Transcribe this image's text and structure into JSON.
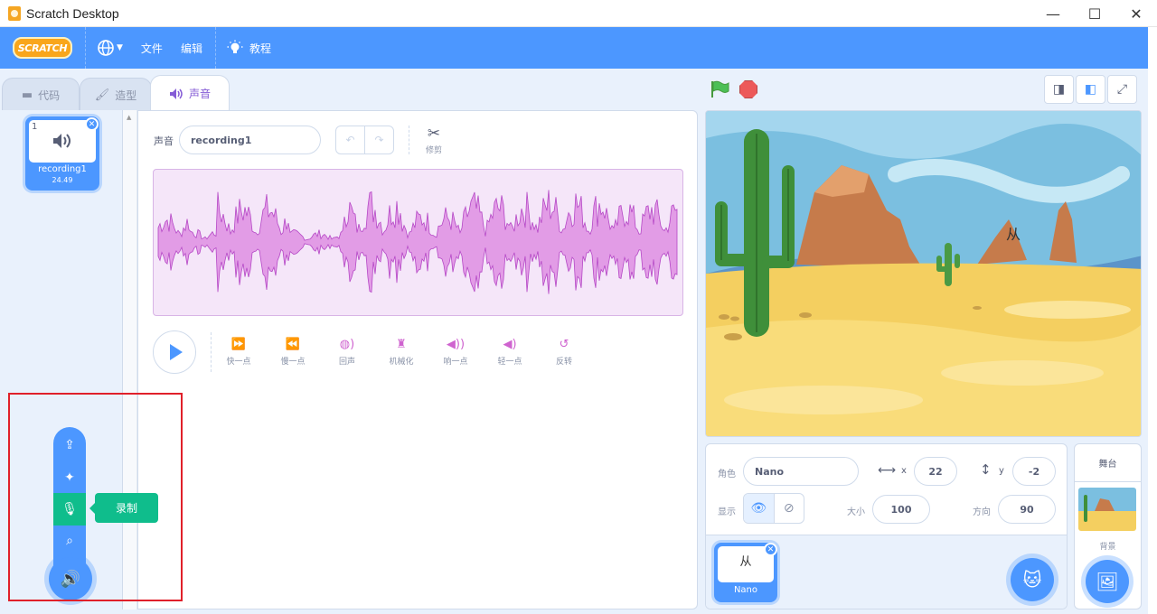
{
  "window": {
    "title": "Scratch Desktop",
    "minimize": "—",
    "maximize": "☐",
    "close": "✕"
  },
  "menubar": {
    "logo": "SCRATCH",
    "file": "文件",
    "edit": "编辑",
    "tutorials": "教程"
  },
  "tabs": {
    "code": "代码",
    "costumes": "造型",
    "sounds": "声音"
  },
  "sound_list": [
    {
      "index": "1",
      "name": "recording1",
      "duration": "24.49"
    }
  ],
  "editor": {
    "sound_label": "声音",
    "sound_name": "recording1",
    "trim_label": "修剪",
    "effects": [
      {
        "label": "快一点",
        "icon": "faster-icon"
      },
      {
        "label": "慢一点",
        "icon": "slower-icon"
      },
      {
        "label": "回声",
        "icon": "echo-icon"
      },
      {
        "label": "机械化",
        "icon": "robot-icon"
      },
      {
        "label": "响一点",
        "icon": "louder-icon"
      },
      {
        "label": "轻一点",
        "icon": "softer-icon"
      },
      {
        "label": "反转",
        "icon": "reverse-icon"
      }
    ]
  },
  "upload_menu": {
    "tooltip": "录制",
    "active_item": "record"
  },
  "sprite_info": {
    "sprite_label": "角色",
    "sprite_name": "Nano",
    "x_label": "x",
    "x": "22",
    "y_label": "y",
    "y": "-2",
    "show_label": "显示",
    "size_label": "大小",
    "size": "100",
    "direction_label": "方向",
    "direction": "90"
  },
  "sprites": [
    {
      "name": "Nano",
      "thumb_text": "从"
    }
  ],
  "stage_text": "从",
  "stage_selector": {
    "header": "舞台",
    "backdrops_label": "背景"
  },
  "colors": {
    "accent": "#4c97ff",
    "sound": "#cf63cf",
    "record": "#0fbd8c",
    "highlight": "#e0202a"
  }
}
